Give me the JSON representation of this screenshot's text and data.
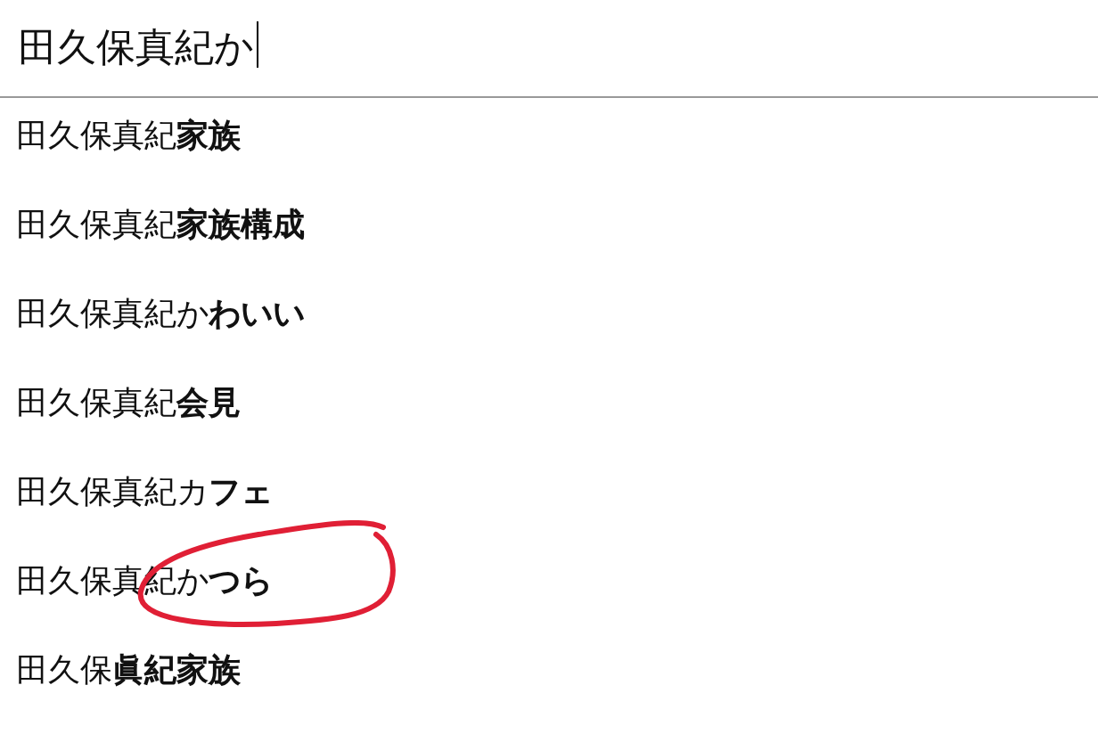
{
  "search": {
    "value": "田久保真紀か",
    "focused": true
  },
  "suggestions": [
    {
      "text": "田久保真紀**家族**"
    },
    {
      "text": "田久保真紀**家族構成**"
    },
    {
      "text": "田久保真紀か**わいい**"
    },
    {
      "text": "田久保真紀**会見**"
    },
    {
      "text": "田久保真紀カ**フェ**"
    },
    {
      "text": "田久保真紀か**つら**"
    },
    {
      "text": "田久保**眞紀家族**"
    }
  ],
  "annotation": {
    "kind": "circle"
  }
}
